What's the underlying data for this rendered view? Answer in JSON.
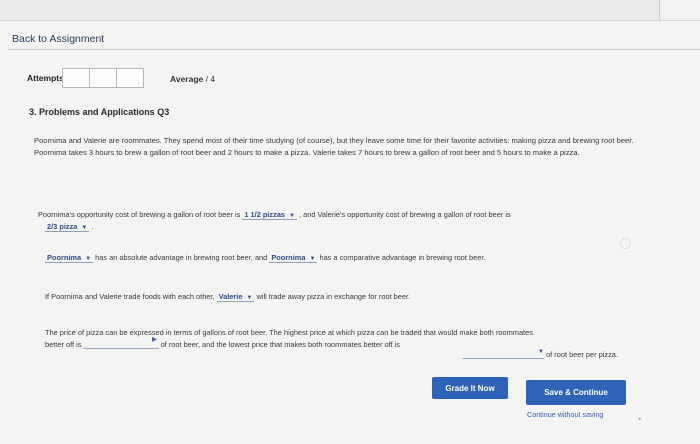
{
  "nav": {
    "back": "Back to Assignment"
  },
  "attempts": {
    "label": "Attempts",
    "average_label": "Average",
    "average_value": "/ 4"
  },
  "question": {
    "title": "3. Problems and Applications Q3",
    "intro": "Poornima and Valerie are roommates. They spend most of their time studying (of course), but they leave some time for their favorite activities: making pizza and brewing root beer. Poornima takes 3 hours to brew a gallon of root beer and 2 hours to make a pizza. Valerie takes 7 hours to brew a gallon of root beer and 5 hours to make a pizza.",
    "opp_cost": {
      "text_before": "Poornima's opportunity cost of brewing a gallon of root beer is",
      "select1": "1 1/2 pizzas",
      "text_mid": ", and Valerie's opportunity cost of brewing a gallon of root beer is",
      "select2": "2/3 pizza",
      "text_end": "."
    },
    "advantage": {
      "select1": "Poornima",
      "text1": "has an absolute advantage in brewing root beer, and",
      "select2": "Poornima",
      "text2": "has a comparative advantage in brewing root beer."
    },
    "trade": {
      "text1": "If Poornima and Valerie trade foods with each other,",
      "select": "Valerie",
      "text2": "will trade away pizza in exchange for root beer."
    },
    "price": {
      "line1": "The price of pizza can be expressed in terms of gallons of root beer. The highest price at which pizza can be traded that would make both roommates",
      "line2a": "better off is",
      "line2b": "of root beer, and the lowest price that makes both roommates better off is",
      "line2c": "of root beer per pizza."
    }
  },
  "buttons": {
    "grade": "Grade It Now",
    "save": "Save & Continue",
    "continue": "Continue without saving"
  }
}
